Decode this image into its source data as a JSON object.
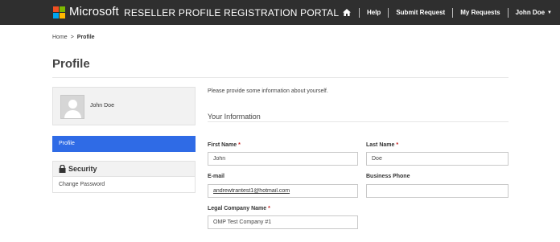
{
  "header": {
    "brand": "Microsoft",
    "portal_title": "RESELLER PROFILE REGISTRATION PORTAL",
    "nav": {
      "home_icon": "home-icon",
      "help": "Help",
      "submit_request": "Submit Request",
      "my_requests": "My Requests",
      "user": "John Doe"
    },
    "background_color": "#2f2f2f"
  },
  "breadcrumb": {
    "home": "Home",
    "separator": ">",
    "current": "Profile"
  },
  "page_title": "Profile",
  "sidebar": {
    "profile_name": "John Doe",
    "active_item": "Profile",
    "active_color": "#2f6be6",
    "section_title": "Security",
    "section_icon": "lock-icon",
    "items": [
      "Change Password"
    ]
  },
  "main": {
    "intro": "Please provide some information about yourself.",
    "section_title": "Your Information",
    "fields": {
      "first_name": {
        "label": "First Name",
        "required": "*",
        "value": "John"
      },
      "last_name": {
        "label": "Last Name",
        "required": "*",
        "value": "Doe"
      },
      "email": {
        "label": "E-mail",
        "value": "andrewtrantest1@hotmail.com"
      },
      "business_phone": {
        "label": "Business Phone",
        "value": ""
      },
      "legal_company_name": {
        "label": "Legal Company Name",
        "required": "*",
        "value": "OMP Test Company #1"
      }
    }
  }
}
